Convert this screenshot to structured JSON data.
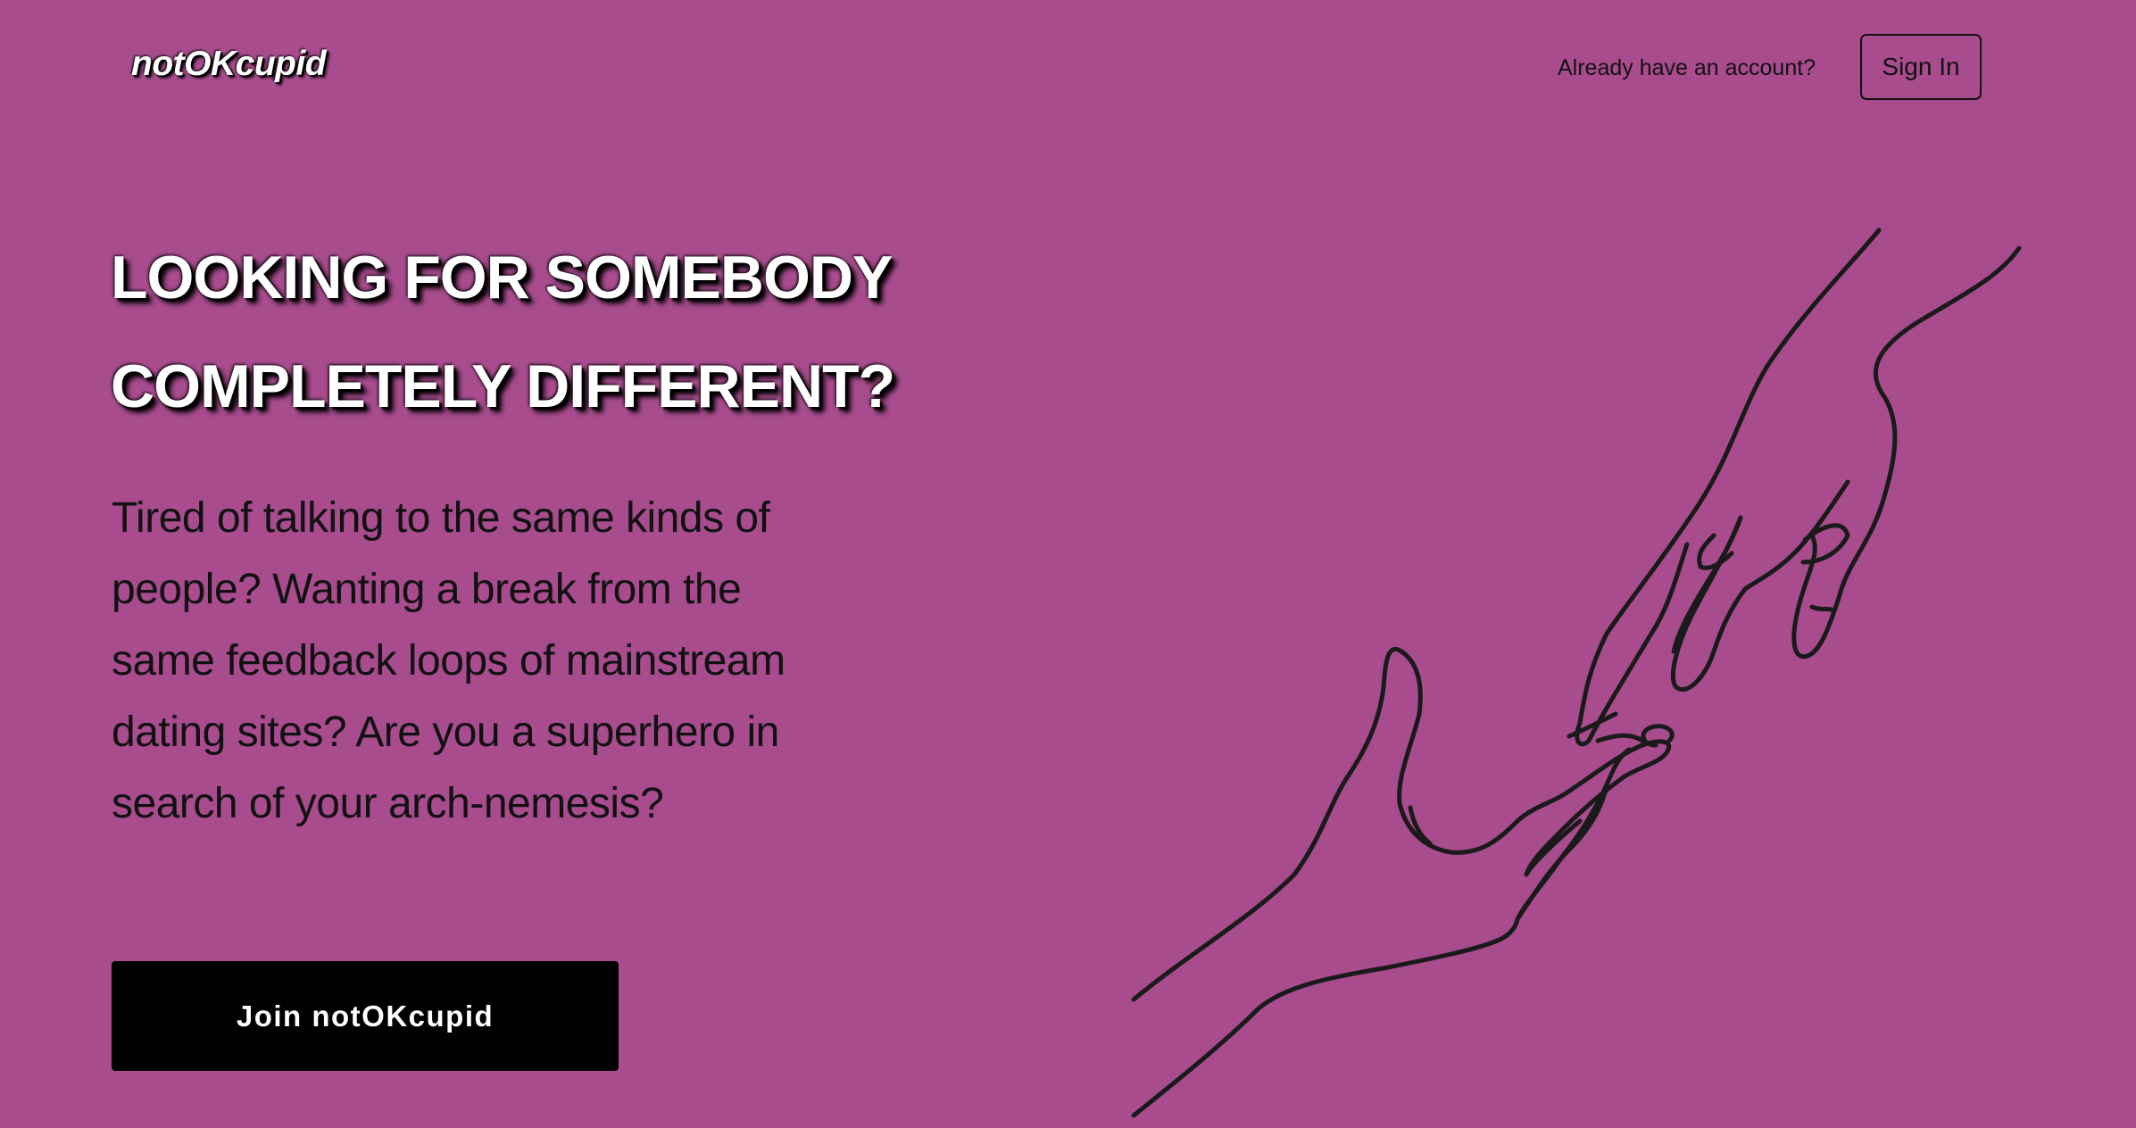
{
  "header": {
    "logo": "notOKcupid",
    "account_prompt": "Already have an account?",
    "signin_label": "Sign In"
  },
  "hero": {
    "headline_line1": "LOOKING FOR SOMEBODY",
    "headline_line2": "COMPLETELY DIFFERENT?",
    "lead": "Tired of talking to the same kinds of people? Wanting a break from the same feedback loops of mainstream dating sites? Are you a superhero in search of your arch-nemesis?",
    "cta_label": "Join notOKcupid"
  },
  "illustration": {
    "icon": "reaching-hands-line-art"
  },
  "colors": {
    "background": "#a84c8e",
    "cta_background": "#000000",
    "headline_text": "#ffffff",
    "body_text": "#111111"
  }
}
